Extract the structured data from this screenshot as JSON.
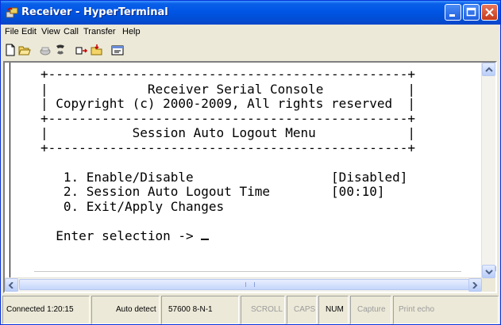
{
  "window": {
    "title": "Receiver - HyperTerminal"
  },
  "menu": [
    "File",
    "Edit",
    "View",
    "Call",
    "Transfer",
    "Help"
  ],
  "toolbar": [
    "new-connection-icon",
    "open-icon",
    "disconnect-icon",
    "dial-icon",
    "send-icon",
    "receive-icon",
    "properties-icon"
  ],
  "terminal": {
    "lines": [
      "+-----------------------------------------------+",
      "|             Receiver Serial Console           |",
      "| Copyright (c) 2000-2009, All rights reserved  |",
      "+-----------------------------------------------+",
      "|           Session Auto Logout Menu            |",
      "+-----------------------------------------------+",
      "",
      "   1. Enable/Disable                  [Disabled]",
      "   2. Session Auto Logout Time        [00:10]",
      "   0. Exit/Apply Changes",
      "",
      "  Enter selection -> "
    ]
  },
  "status": {
    "connected": "Connected 1:20:15",
    "detect": "Auto detect",
    "params": "57600 8-N-1",
    "scroll": "SCROLL",
    "caps": "CAPS",
    "num": "NUM",
    "capture": "Capture",
    "print_echo": "Print echo"
  }
}
